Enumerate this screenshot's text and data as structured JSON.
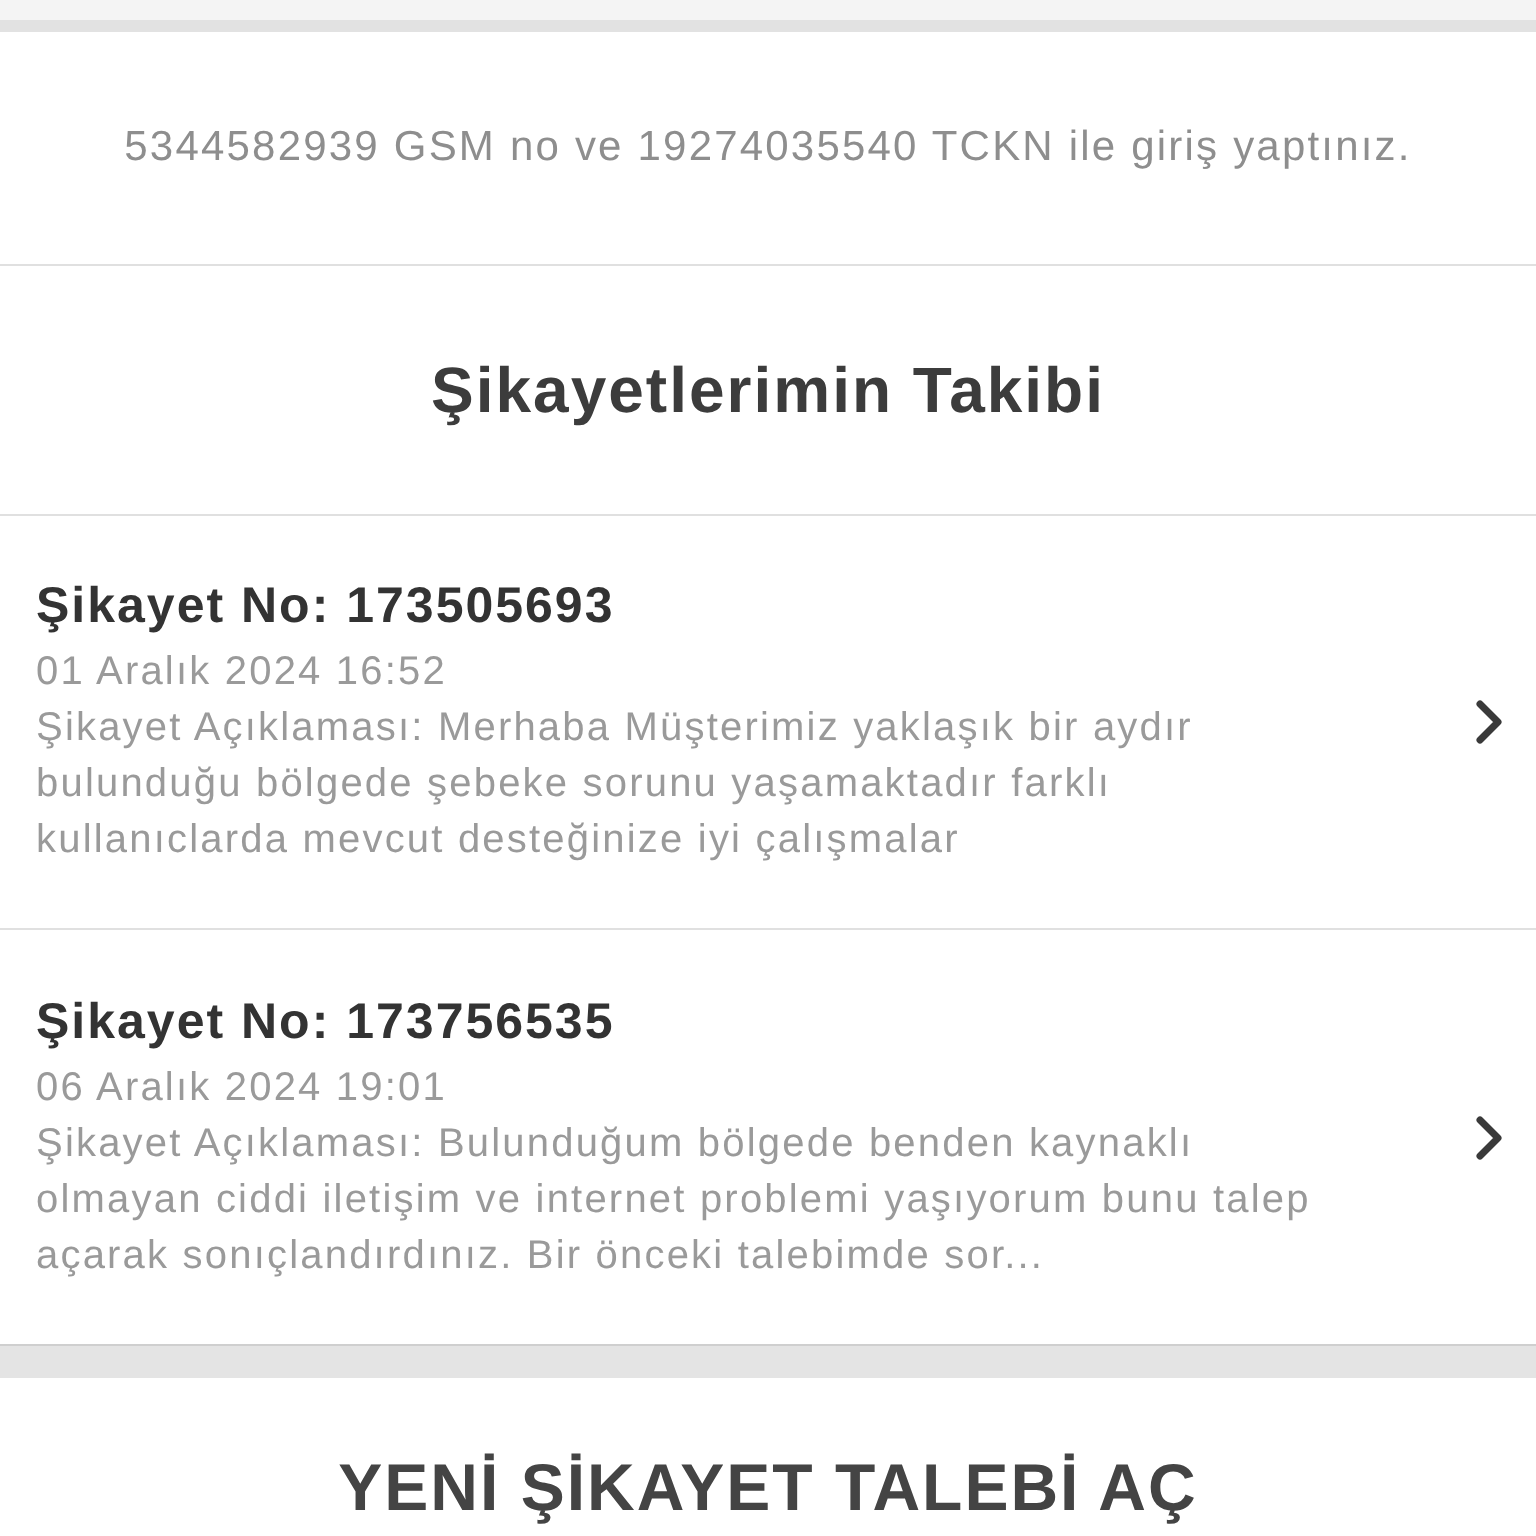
{
  "login_info": "5344582939 GSM no ve 19274035540 TCKN ile giriş yaptınız.",
  "section_title": "Şikayetlerimin Takibi",
  "complaints": [
    {
      "number": "Şikayet No: 173505693",
      "date": "01 Aralık 2024 16:52",
      "description": "Şikayet Açıklaması: Merhaba Müşterimiz yaklaşık bir aydır bulunduğu bölgede şebeke sorunu yaşamaktadır farklı kullanıclarda mevcut desteğinize iyi çalışmalar"
    },
    {
      "number": "Şikayet No: 173756535",
      "date": "06 Aralık 2024 19:01",
      "description": "Şikayet Açıklaması: Bulunduğum bölgede benden kaynaklı olmayan ciddi iletişim ve internet problemi yaşıyorum bunu talep açarak sonıçlandırdınız. Bir önceki talebimde sor..."
    }
  ],
  "new_request_title": "YENİ ŞİKAYET TALEBİ AÇ"
}
